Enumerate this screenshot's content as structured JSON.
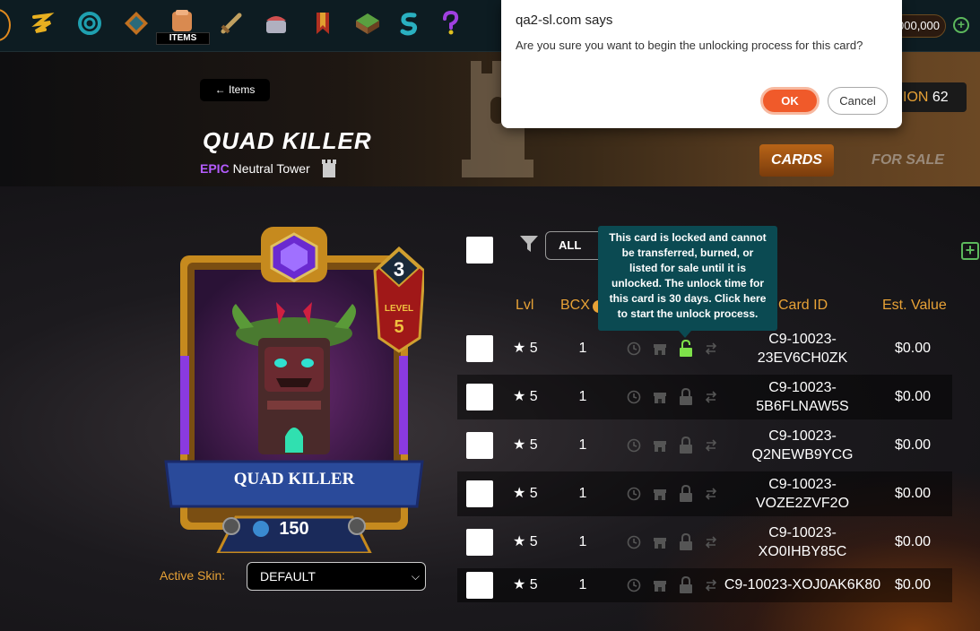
{
  "nav": {
    "icons": [
      "splinters-icon",
      "spiral-icon",
      "guild-icon",
      "items-icon",
      "sword-icon",
      "shop-icon",
      "banner-icon",
      "land-icon",
      "sps-icon",
      "question-icon"
    ],
    "items_label": "ITEMS",
    "balance": "000,000"
  },
  "header": {
    "back_label": "Items",
    "title": "QUAD KILLER",
    "rarity": "EPIC",
    "type": "Neutral Tower",
    "edition_label": "ION",
    "edition_number": "62",
    "tabs": [
      "CARDS",
      "FOR SALE"
    ]
  },
  "card": {
    "name": "QUAD KILLER",
    "level_word": "LEVEL",
    "level": "5",
    "mana": "3",
    "power": "150"
  },
  "skin": {
    "label": "Active Skin:",
    "selected": "DEFAULT"
  },
  "table": {
    "filter_label": "ALL CARDS",
    "headers": {
      "lvl": "Lvl",
      "bcx": "BCX",
      "card_id": "Card ID",
      "est_value": "Est. Value"
    },
    "rows": [
      {
        "level": "★ 5",
        "bcx": "1",
        "id_line1": "C9-10023-",
        "id_line2": "23EV6CH0ZK",
        "value": "$0.00",
        "unlocked_icon": true
      },
      {
        "level": "★ 5",
        "bcx": "1",
        "id_line1": "C9-10023-",
        "id_line2": "5B6FLNAW5S",
        "value": "$0.00"
      },
      {
        "level": "★ 5",
        "bcx": "1",
        "id_line1": "C9-10023-",
        "id_line2": "Q2NEWB9YCG",
        "value": "$0.00"
      },
      {
        "level": "★ 5",
        "bcx": "1",
        "id_line1": "C9-10023-",
        "id_line2": "VOZE2ZVF2O",
        "value": "$0.00"
      },
      {
        "level": "★ 5",
        "bcx": "1",
        "id_line1": "C9-10023-",
        "id_line2": "XO0IHBY85C",
        "value": "$0.00"
      },
      {
        "level": "★ 5",
        "bcx": "1",
        "id_line1": "C9-10023-XOJ0AK6K80",
        "id_line2": "",
        "value": "$0.00"
      }
    ]
  },
  "tooltip": {
    "text": "This card is locked and cannot be transferred, burned, or listed for sale until it is unlocked. The unlock time for this card is 30 days. Click here to start the unlock process."
  },
  "dialog": {
    "title": "qa2-sl.com says",
    "message": "Are you sure you want to begin the unlocking process for this card?",
    "ok_label": "OK",
    "cancel_label": "Cancel"
  },
  "colors": {
    "accent_orange": "#e8a236",
    "epic_purple": "#b45cff",
    "tooltip_teal": "#0b4a52",
    "ok_button": "#f05a2a",
    "unlock_green": "#7ee04a"
  }
}
